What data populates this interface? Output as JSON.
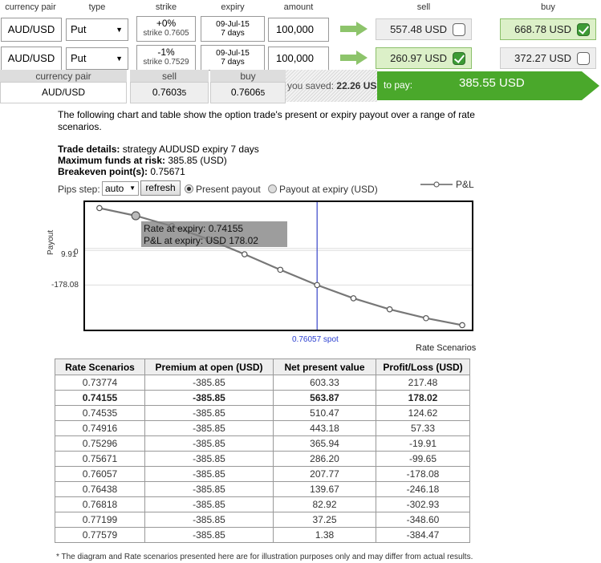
{
  "columns": {
    "currency_pair": "currency pair",
    "type": "type",
    "strike": "strike",
    "expiry": "expiry",
    "amount": "amount",
    "sell": "sell",
    "buy": "buy"
  },
  "trades": [
    {
      "pair": "AUD/USD",
      "type": "Put",
      "strike_pct": "+0%",
      "strike_sub": "strike 0.7605",
      "expiry_date": "09-Jul-15",
      "expiry_days": "7 days",
      "amount": "100,000",
      "sell": "557.48 USD",
      "sell_checked": false,
      "buy": "668.78 USD",
      "buy_checked": true
    },
    {
      "pair": "AUD/USD",
      "type": "Put",
      "strike_pct": "-1%",
      "strike_sub": "strike 0.7529",
      "expiry_date": "09-Jul-15",
      "expiry_days": "7 days",
      "amount": "100,000",
      "sell": "260.97 USD",
      "sell_checked": true,
      "buy": "372.27 USD",
      "buy_checked": false
    }
  ],
  "summary": {
    "hdr_pair": "currency pair",
    "hdr_sell": "sell",
    "hdr_buy": "buy",
    "pair": "AUD/USD",
    "sell_main": "0.7603",
    "sell_pip": "5",
    "buy_main": "0.7606",
    "buy_pip": "5",
    "saved_label": "you saved:",
    "saved_value": "22.26 USD",
    "to_pay_label": "to pay:",
    "to_pay_value": "385.55 USD"
  },
  "intro": "The following chart and table show the option trade's present or expiry payout over a range of rate scenarios.",
  "details": {
    "strategy_label": "Trade details:",
    "strategy_value": "strategy AUDUSD expiry 7 days",
    "funds_label": "Maximum funds at risk:",
    "funds_value": "385.85 (USD)",
    "breakeven_label": "Breakeven point(s):",
    "breakeven_value": "0.75671"
  },
  "controls": {
    "pips_label": "Pips step:",
    "pips_value": "auto",
    "refresh": "refresh",
    "present": "Present payout",
    "expiry": "Payout at expiry (USD)",
    "legend": "P&L"
  },
  "chart_data": {
    "type": "line",
    "ylabel": "Payout",
    "xlabel": "Rate Scenarios",
    "yticks": [
      "9.91",
      "0",
      "-178.08"
    ],
    "spot_label": "0.76057 spot",
    "tooltip": {
      "line1": "Rate at expiry: 0.74155",
      "line2": "P&L at expiry: USD 178.02"
    },
    "highlight_index": 1,
    "spot_index": 6,
    "series": [
      {
        "name": "P&L",
        "x": [
          0.73774,
          0.74155,
          0.74535,
          0.74916,
          0.75296,
          0.75671,
          0.76057,
          0.76438,
          0.76818,
          0.77199,
          0.77579
        ],
        "values": [
          217.48,
          178.02,
          124.62,
          57.33,
          -19.91,
          -99.65,
          -178.08,
          -246.18,
          -302.93,
          -348.6,
          -384.47
        ]
      }
    ]
  },
  "table": {
    "headers": [
      "Rate Scenarios",
      "Premium at open (USD)",
      "Net present value",
      "Profit/Loss (USD)"
    ],
    "rows": [
      [
        "0.73774",
        "-385.85",
        "603.33",
        "217.48"
      ],
      [
        "0.74155",
        "-385.85",
        "563.87",
        "178.02"
      ],
      [
        "0.74535",
        "-385.85",
        "510.47",
        "124.62"
      ],
      [
        "0.74916",
        "-385.85",
        "443.18",
        "57.33"
      ],
      [
        "0.75296",
        "-385.85",
        "365.94",
        "-19.91"
      ],
      [
        "0.75671",
        "-385.85",
        "286.20",
        "-99.65"
      ],
      [
        "0.76057",
        "-385.85",
        "207.77",
        "-178.08"
      ],
      [
        "0.76438",
        "-385.85",
        "139.67",
        "-246.18"
      ],
      [
        "0.76818",
        "-385.85",
        "82.92",
        "-302.93"
      ],
      [
        "0.77199",
        "-385.85",
        "37.25",
        "-348.60"
      ],
      [
        "0.77579",
        "-385.85",
        "1.38",
        "-384.47"
      ]
    ],
    "bold_row": 1
  },
  "footnote": "* The diagram and Rate scenarios presented here are for illustration purposes only and may differ from actual results."
}
